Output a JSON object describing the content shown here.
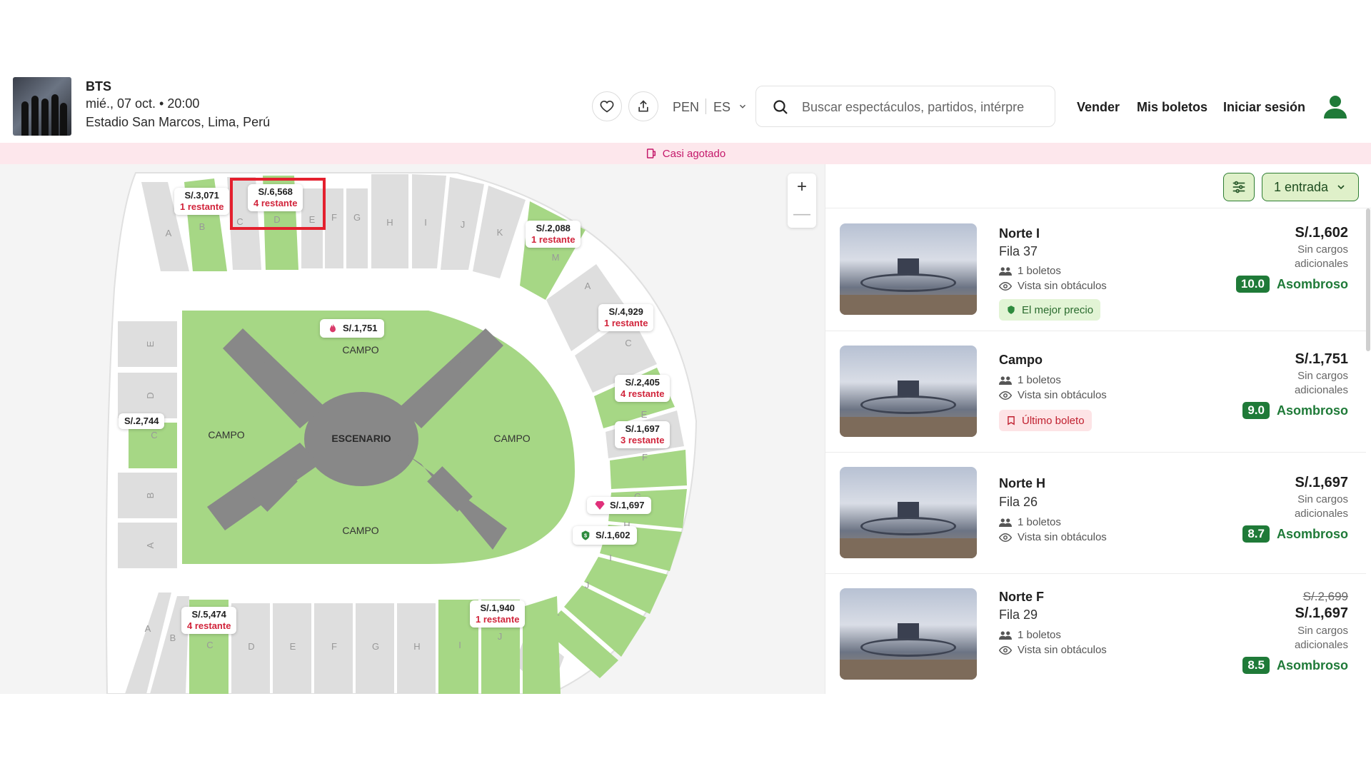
{
  "event": {
    "title": "BTS",
    "date": "mié., 07 oct. • 20:00",
    "venue": "Estadio San Marcos, Lima, Perú"
  },
  "header": {
    "currency": "PEN",
    "language": "ES",
    "search_placeholder": "Buscar espectáculos, partidos, intérpre",
    "nav": {
      "sell": "Vender",
      "my_tickets": "Mis boletos",
      "login": "Iniciar sesión"
    }
  },
  "banner": {
    "text": "Casi agotado"
  },
  "map": {
    "zones": {
      "campo_top": "CAMPO",
      "campo_left": "CAMPO",
      "campo_right": "CAMPO",
      "campo_bottom": "CAMPO",
      "stage": "ESCENARIO"
    },
    "section_letters_top": [
      "A",
      "B",
      "C",
      "D",
      "E",
      "F",
      "G",
      "H",
      "I",
      "J",
      "K",
      "M"
    ],
    "section_letters_left": [
      "E",
      "D",
      "C",
      "B",
      "A"
    ],
    "section_letters_right": [
      "A",
      "C",
      "E",
      "F",
      "G",
      "H",
      "I",
      "J",
      "K",
      "L"
    ],
    "section_letters_bottom": [
      "A",
      "B",
      "C",
      "D",
      "E",
      "F",
      "G",
      "H",
      "I",
      "J",
      "K"
    ],
    "zoom_in": "+",
    "zoom_out": "—",
    "price_tags": [
      {
        "price": "S/.3,071",
        "remaining": "1 restante"
      },
      {
        "price": "S/.6,568",
        "remaining": "4 restante"
      },
      {
        "price": "S/.2,088",
        "remaining": "1 restante"
      },
      {
        "price": "S/.1,751",
        "remaining": ""
      },
      {
        "price": "S/.4,929",
        "remaining": "1 restante"
      },
      {
        "price": "S/.2,405",
        "remaining": "4 restante"
      },
      {
        "price": "S/.1,697",
        "remaining": "3 restante"
      },
      {
        "price": "S/.2,744",
        "remaining": ""
      },
      {
        "price": "S/.1,697",
        "remaining": ""
      },
      {
        "price": "S/.1,602",
        "remaining": ""
      },
      {
        "price": "S/.5,474",
        "remaining": "4 restante"
      },
      {
        "price": "S/.1,940",
        "remaining": "1 restante"
      }
    ]
  },
  "listings_toolbar": {
    "quantity": "1 entrada"
  },
  "listings": [
    {
      "name": "Norte I",
      "row": "Fila 37",
      "tickets": "1 boletos",
      "view": "Vista sin obtáculos",
      "badge": "El mejor precio",
      "price": "S/.1,602",
      "old_price": "",
      "fees": "Sin cargos adicionales",
      "score": "10.0",
      "rating_word": "Asombroso"
    },
    {
      "name": "Campo",
      "row": "",
      "tickets": "1 boletos",
      "view": "Vista sin obtáculos",
      "badge": "Último boleto",
      "price": "S/.1,751",
      "old_price": "",
      "fees": "Sin cargos adicionales",
      "score": "9.0",
      "rating_word": "Asombroso"
    },
    {
      "name": "Norte H",
      "row": "Fila 26",
      "tickets": "1 boletos",
      "view": "Vista sin obtáculos",
      "badge": "",
      "price": "S/.1,697",
      "old_price": "",
      "fees": "Sin cargos adicionales",
      "score": "8.7",
      "rating_word": "Asombroso"
    },
    {
      "name": "Norte F",
      "row": "Fila 29",
      "tickets": "1 boletos",
      "view": "Vista sin obtáculos",
      "badge": "",
      "price": "S/.1,697",
      "old_price": "S/.2,699",
      "fees": "Sin cargos adicionales",
      "score": "8.5",
      "rating_word": "Asombroso"
    }
  ],
  "colors": {
    "available_section": "#a6d785",
    "unavailable_section": "#dedede",
    "brand_green": "#1f7a38",
    "alert_red": "#d1243b",
    "banner_pink": "#fde7ec"
  }
}
